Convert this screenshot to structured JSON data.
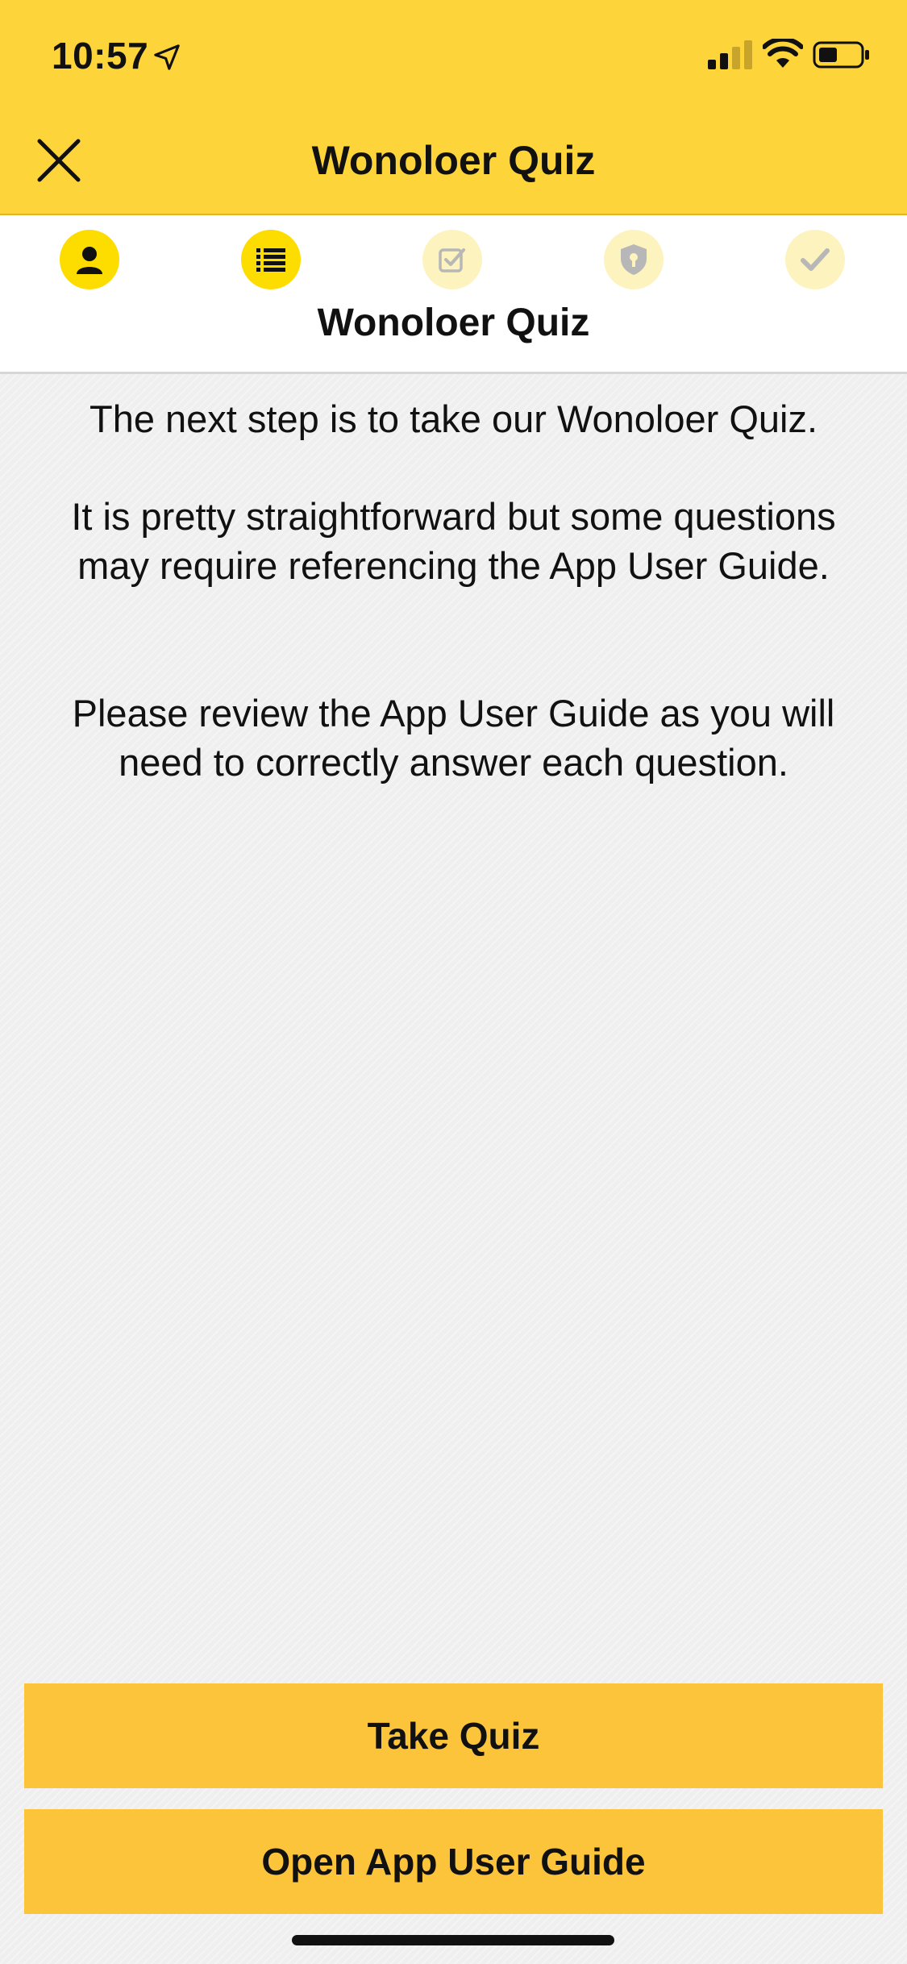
{
  "status_bar": {
    "time": "10:57",
    "icons": [
      "location-arrow-icon",
      "cellular-signal-icon",
      "wifi-icon",
      "battery-icon"
    ]
  },
  "nav": {
    "title": "Wonoloer Quiz",
    "close_icon": "close-icon"
  },
  "stepper": {
    "current_label": "Wonoloer Quiz",
    "steps": [
      {
        "icon": "person-icon",
        "state": "completed"
      },
      {
        "icon": "list-icon",
        "state": "current"
      },
      {
        "icon": "checkbox-icon",
        "state": "upcoming"
      },
      {
        "icon": "shield-lock-icon",
        "state": "upcoming"
      },
      {
        "icon": "checkmark-icon",
        "state": "upcoming"
      }
    ]
  },
  "content": {
    "paragraphs": [
      "The next step is to take our Wonoloer Quiz.",
      "It is pretty straightforward but some questions may require referencing the App User Guide.",
      "Please review the App User Guide as you will need to correctly answer each question."
    ]
  },
  "actions": {
    "take_quiz": "Take Quiz",
    "open_guide": "Open App User Guide"
  },
  "colors": {
    "header_yellow": "#fdd53a",
    "step_active": "#fddc00",
    "step_inactive": "#fdf3bf",
    "button": "#fbc43a"
  }
}
